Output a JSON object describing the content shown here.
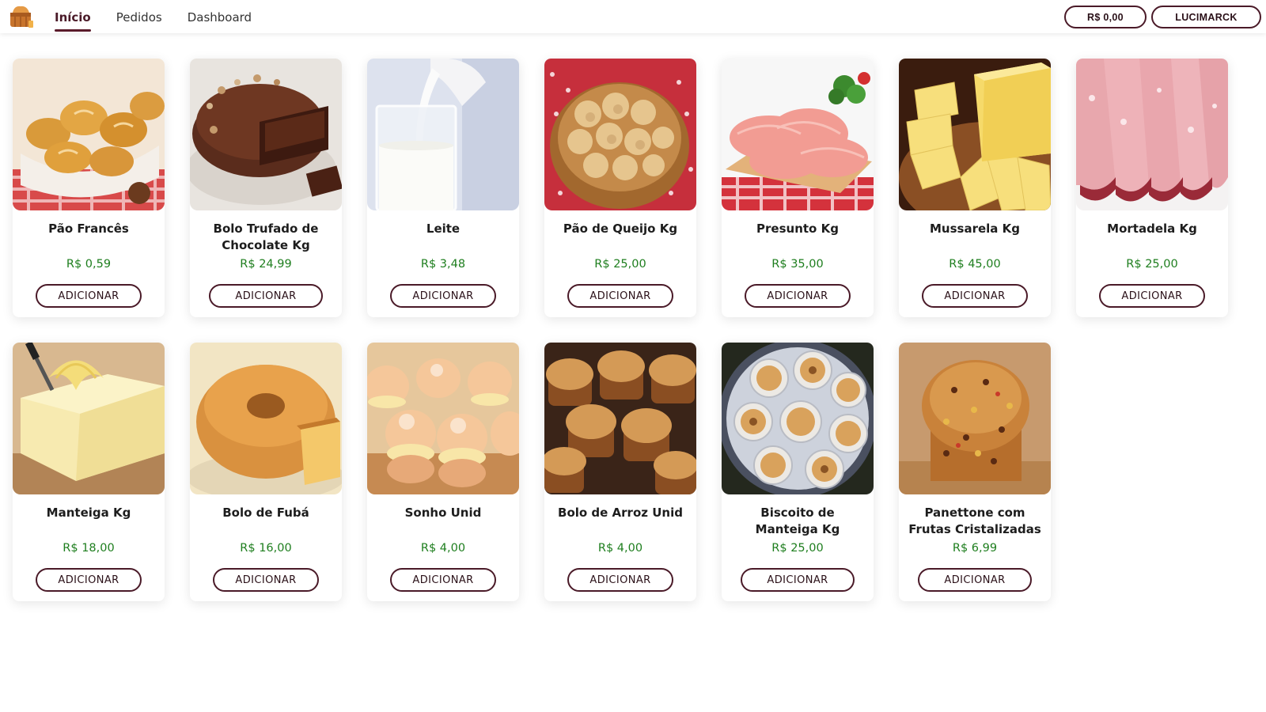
{
  "nav": {
    "logo_icon": "bakery-basket-icon",
    "links": [
      {
        "label": "Início",
        "active": true
      },
      {
        "label": "Pedidos",
        "active": false
      },
      {
        "label": "Dashboard",
        "active": false
      }
    ],
    "cart_total": "R$ 0,00",
    "user_name": "LUCIMARCK"
  },
  "colors": {
    "accent": "#4a1a28",
    "price": "#1e7e1e"
  },
  "add_label": "ADICIONAR",
  "products": [
    {
      "name": "Pão Francês",
      "price": "R$ 0,59",
      "image": "bread-rolls"
    },
    {
      "name": "Bolo Trufado de Chocolate Kg",
      "price": "R$ 24,99",
      "image": "chocolate-cake"
    },
    {
      "name": "Leite",
      "price": "R$ 3,48",
      "image": "milk-glass"
    },
    {
      "name": "Pão de Queijo Kg",
      "price": "R$ 25,00",
      "image": "cheese-bread-basket"
    },
    {
      "name": "Presunto Kg",
      "price": "R$ 35,00",
      "image": "ham-slices"
    },
    {
      "name": "Mussarela Kg",
      "price": "R$ 45,00",
      "image": "mozzarella-cheese"
    },
    {
      "name": "Mortadela Kg",
      "price": "R$ 25,00",
      "image": "mortadella-slices"
    },
    {
      "name": "Manteiga Kg",
      "price": "R$ 18,00",
      "image": "butter-block"
    },
    {
      "name": "Bolo de Fubá",
      "price": "R$ 16,00",
      "image": "cornmeal-cake"
    },
    {
      "name": "Sonho Unid",
      "price": "R$ 4,00",
      "image": "cream-doughnuts"
    },
    {
      "name": "Bolo de Arroz Unid",
      "price": "R$ 4,00",
      "image": "rice-cakes"
    },
    {
      "name": "Biscoito de Manteiga Kg",
      "price": "R$ 25,00",
      "image": "butter-cookies-tin"
    },
    {
      "name": "Panettone com Frutas Cristalizadas",
      "price": "R$ 6,99",
      "image": "panettone"
    }
  ]
}
